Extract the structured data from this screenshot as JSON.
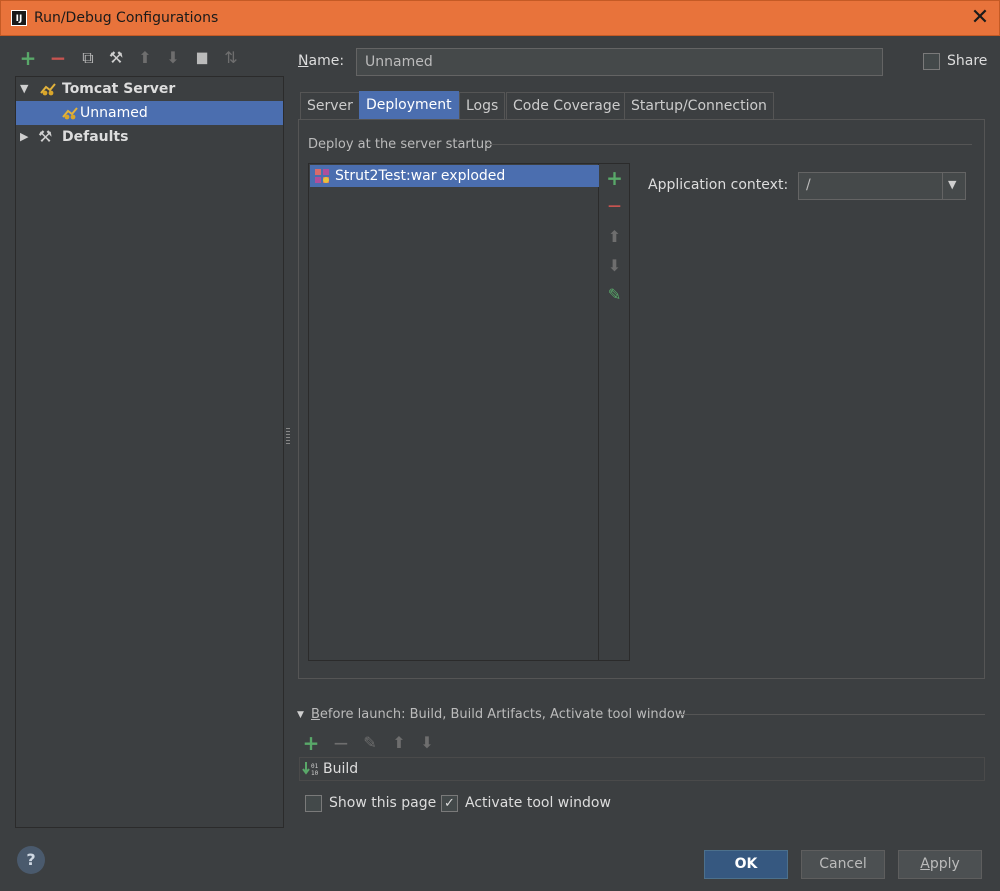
{
  "window": {
    "title": "Run/Debug Configurations",
    "app_icon": "IJ",
    "close_glyph": "✕"
  },
  "colors": {
    "title_bar": "#e8733b",
    "selection": "#4b6eaf",
    "add_green": "#59a869",
    "remove_red": "#c75450"
  },
  "toolbar": {
    "icons": [
      "add-icon",
      "remove-icon",
      "copy-icon",
      "wrench-icon",
      "move-up-icon",
      "move-down-icon",
      "folder-icon",
      "sort-icon"
    ],
    "glyphs": {
      "add": "+",
      "remove": "−",
      "copy": "⧉",
      "wrench": "⚒",
      "up": "⬆",
      "down": "⬇",
      "folder": "▆",
      "sort": "⇅"
    }
  },
  "tree": {
    "items": [
      {
        "label": "Tomcat Server",
        "expanded": true,
        "icon": "tomcat-icon"
      },
      {
        "label": "Unnamed",
        "selected": true,
        "icon": "tomcat-icon"
      },
      {
        "label": "Defaults",
        "expanded": false,
        "icon": "wrench-icon"
      }
    ],
    "arrow_expanded": "▼",
    "arrow_collapsed": "▶"
  },
  "name": {
    "label": "Name:",
    "value": "Unnamed"
  },
  "share": {
    "label": "Share",
    "checked": false
  },
  "tabs": [
    {
      "label": "Server"
    },
    {
      "label": "Deployment",
      "active": true
    },
    {
      "label": "Logs"
    },
    {
      "label": "Code Coverage"
    },
    {
      "label": "Startup/Connection"
    }
  ],
  "deployment": {
    "section_title": "Deploy at the server startup",
    "items": [
      {
        "label": "Strut2Test:war exploded",
        "icon": "artifact-icon",
        "selected": true
      }
    ],
    "side_glyphs": {
      "add": "+",
      "remove": "—",
      "up": "⬆",
      "down": "⬇",
      "edit": "✎"
    },
    "app_context": {
      "label": "Application context:",
      "value": "/",
      "arrow": "▼"
    }
  },
  "before_launch": {
    "title": "Before launch: Build, Build Artifacts, Activate tool window",
    "toggle": "▼",
    "glyphs": {
      "add": "+",
      "remove": "−",
      "edit": "✎",
      "up": "⬆",
      "down": "⬇"
    },
    "items": [
      {
        "label": "Build",
        "icon": "build-icon"
      }
    ],
    "build_icon_text": "01\n10",
    "show_this_page": {
      "label": "Show this page",
      "checked": false
    },
    "activate_tool_window": {
      "label": "Activate tool window",
      "checked": true,
      "check_glyph": "✓"
    }
  },
  "buttons": {
    "ok": "OK",
    "cancel": "Cancel",
    "apply": "Apply",
    "help": "?"
  }
}
